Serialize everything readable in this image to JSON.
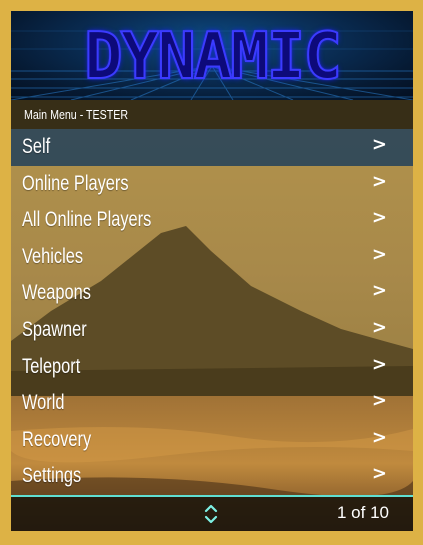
{
  "menu": {
    "banner_title": "DYNAMIC",
    "subtitle": "Main Menu - TESTER",
    "items": [
      {
        "label": "Self",
        "arrow": ">",
        "selected": true
      },
      {
        "label": "Online Players",
        "arrow": ">"
      },
      {
        "label": "All Online Players",
        "arrow": ">"
      },
      {
        "label": "Vehicles",
        "arrow": ">"
      },
      {
        "label": "Weapons",
        "arrow": ">"
      },
      {
        "label": "Spawner",
        "arrow": ">"
      },
      {
        "label": "Teleport",
        "arrow": ">"
      },
      {
        "label": "World",
        "arrow": ">"
      },
      {
        "label": "Recovery",
        "arrow": ">"
      },
      {
        "label": "Settings",
        "arrow": ">"
      }
    ],
    "footer": {
      "page_indicator": "1 of 10",
      "scroll_icon": "up-down-chevron-icon"
    }
  },
  "colors": {
    "outer_border": "#ddb245",
    "selected_row": "#25425a",
    "footer_line": "#5fe0d2",
    "banner_text": "#0d0a7a",
    "banner_outline": "#3b3bff"
  }
}
